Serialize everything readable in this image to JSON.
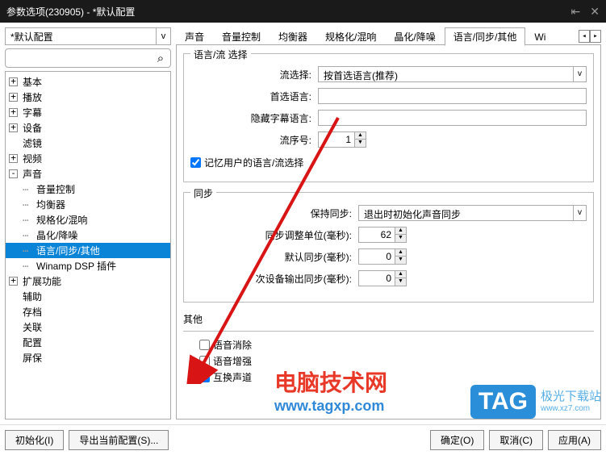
{
  "window": {
    "title": "参数选项(230905) - *默认配置"
  },
  "preset": {
    "selected": "*默认配置",
    "dropdown_glyph": "v"
  },
  "search": {
    "placeholder": "",
    "icon": "⌕"
  },
  "tree": {
    "items": [
      {
        "toggle": "+",
        "label": "基本",
        "depth": 0
      },
      {
        "toggle": "+",
        "label": "播放",
        "depth": 0
      },
      {
        "toggle": "+",
        "label": "字幕",
        "depth": 0
      },
      {
        "toggle": "+",
        "label": "设备",
        "depth": 0
      },
      {
        "toggle": "",
        "label": "滤镜",
        "depth": 0
      },
      {
        "toggle": "+",
        "label": "视频",
        "depth": 0
      },
      {
        "toggle": "-",
        "label": "声音",
        "depth": 0
      },
      {
        "toggle": "",
        "label": "音量控制",
        "depth": 1
      },
      {
        "toggle": "",
        "label": "均衡器",
        "depth": 1
      },
      {
        "toggle": "",
        "label": "规格化/混响",
        "depth": 1
      },
      {
        "toggle": "",
        "label": "晶化/降噪",
        "depth": 1
      },
      {
        "toggle": "",
        "label": "语言/同步/其他",
        "depth": 1,
        "selected": true
      },
      {
        "toggle": "",
        "label": "Winamp DSP 插件",
        "depth": 1
      },
      {
        "toggle": "+",
        "label": "扩展功能",
        "depth": 0
      },
      {
        "toggle": "",
        "label": "辅助",
        "depth": 0
      },
      {
        "toggle": "",
        "label": "存档",
        "depth": 0
      },
      {
        "toggle": "",
        "label": "关联",
        "depth": 0
      },
      {
        "toggle": "",
        "label": "配置",
        "depth": 0
      },
      {
        "toggle": "",
        "label": "屏保",
        "depth": 0
      }
    ]
  },
  "tabs": {
    "items": [
      "声音",
      "音量控制",
      "均衡器",
      "规格化/混响",
      "晶化/降噪",
      "语言/同步/其他",
      "Wi"
    ],
    "active_index": 5,
    "scroll_left": "◂",
    "scroll_right": "▸"
  },
  "lang_section": {
    "title": "语言/流 选择",
    "stream_select_label": "流选择:",
    "stream_select_value": "按首选语言(推荐)",
    "pref_lang_label": "首选语言:",
    "pref_lang_value": "",
    "hidden_sub_label": "隐藏字幕语言:",
    "hidden_sub_value": "",
    "stream_no_label": "流序号:",
    "stream_no_value": "1",
    "remember_label": "记忆用户的语言/流选择",
    "remember_checked": true
  },
  "sync_section": {
    "title": "同步",
    "keep_sync_label": "保持同步:",
    "keep_sync_value": "退出时初始化声音同步",
    "unit_label": "同步调整单位(毫秒):",
    "unit_value": "62",
    "default_label": "默认同步(毫秒):",
    "default_value": "0",
    "secondary_label": "次设备输出同步(毫秒):",
    "secondary_value": "0"
  },
  "other_section": {
    "title": "其他",
    "voice_remove_label": "语音消除",
    "voice_remove_checked": false,
    "voice_enhance_label": "语音增强",
    "voice_enhance_checked": false,
    "swap_channels_label": "互换声道",
    "swap_channels_checked": true
  },
  "footer": {
    "init": "初始化(I)",
    "export": "导出当前配置(S)...",
    "ok": "确定(O)",
    "cancel": "取消(C)",
    "apply": "应用(A)"
  },
  "watermark": {
    "site_name": "电脑技术网",
    "site_url": "www.tagxp.com",
    "tag": "TAG",
    "jiguang": "极光下载站",
    "jiguang_url": "www.xz7.com"
  }
}
